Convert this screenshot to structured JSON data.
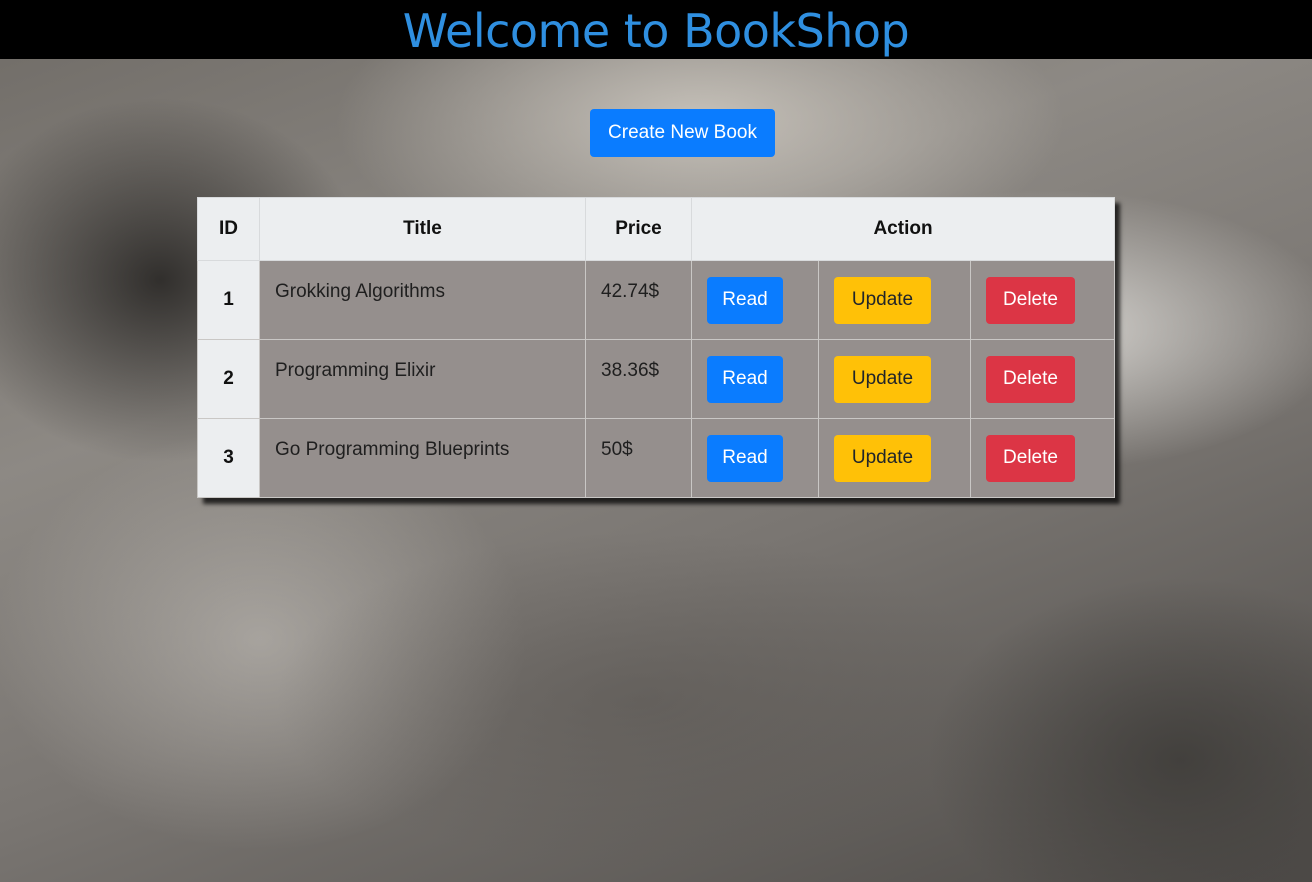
{
  "header": {
    "title": "Welcome to BookShop"
  },
  "toolbar": {
    "create_label": "Create New Book"
  },
  "table": {
    "columns": [
      "ID",
      "Title",
      "Price",
      "Action"
    ],
    "rows": [
      {
        "id": "1",
        "title": "Grokking Algorithms",
        "price": "42.74$",
        "read": "Read",
        "update": "Update",
        "delete": "Delete"
      },
      {
        "id": "2",
        "title": "Programming Elixir",
        "price": "38.36$",
        "read": "Read",
        "update": "Update",
        "delete": "Delete"
      },
      {
        "id": "3",
        "title": "Go Programming Blueprints",
        "price": "50$",
        "read": "Read",
        "update": "Update",
        "delete": "Delete"
      }
    ]
  },
  "colors": {
    "header_bg": "#000000",
    "title_color": "#2f8fe0",
    "primary": "#0a7cff",
    "warning": "#ffc107",
    "danger": "#dc3545"
  }
}
